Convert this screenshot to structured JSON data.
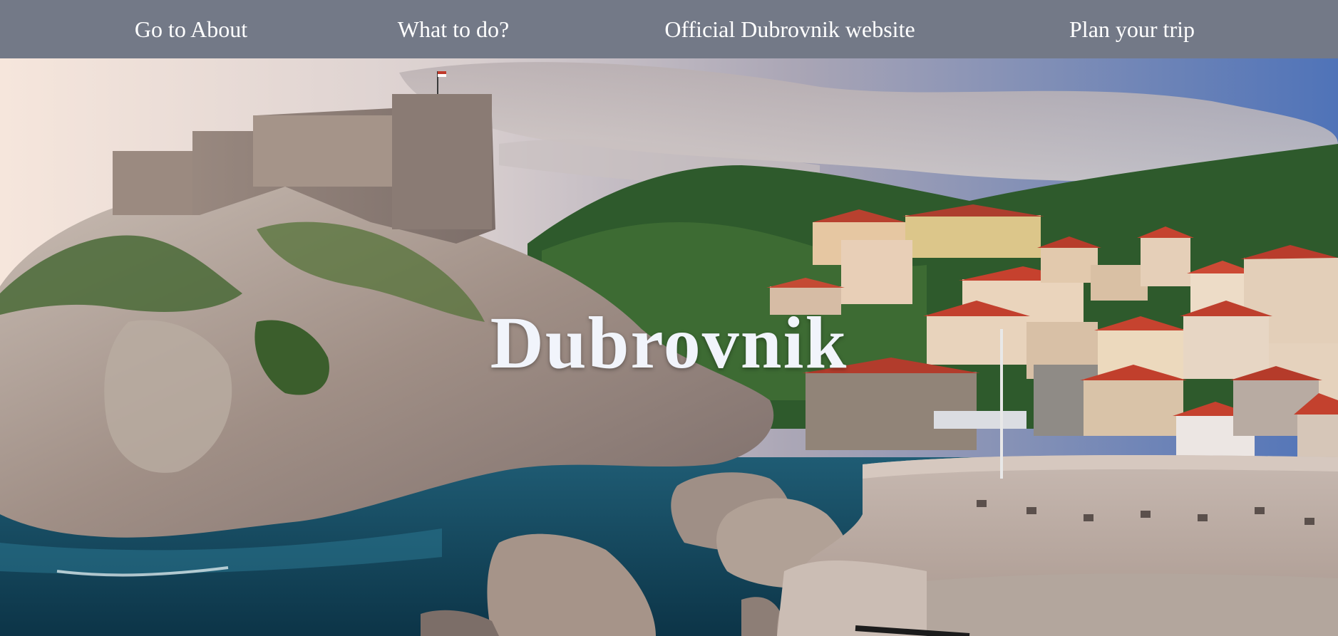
{
  "nav": {
    "items": [
      {
        "label": "Go to About"
      },
      {
        "label": "What to do?"
      },
      {
        "label": "Official Dubrovnik website"
      },
      {
        "label": "Plan your trip"
      }
    ]
  },
  "hero": {
    "title": "Dubrovnik",
    "image": "dubrovnik-fortress-coastline-photo"
  },
  "colors": {
    "nav_background": "#737987",
    "nav_text": "#ffffff",
    "title_text": "#f1f4fb"
  }
}
